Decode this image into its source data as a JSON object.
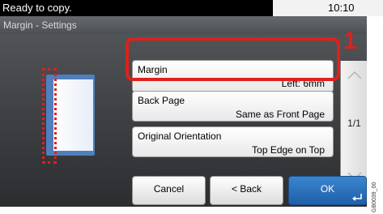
{
  "status": {
    "message": "Ready to copy.",
    "time": "10:10"
  },
  "screen_title": "Margin - Settings",
  "options": [
    {
      "label": "Margin",
      "value": "Left: 6mm"
    },
    {
      "label": "Back Page",
      "value": "Same as Front Page"
    },
    {
      "label": "Original Orientation",
      "value": "Top Edge on Top"
    }
  ],
  "callout_number": "1",
  "pagination": "1/1",
  "buttons": {
    "cancel": "Cancel",
    "back": "< Back",
    "ok": "OK"
  },
  "figure_code": "GB0039_00",
  "colors": {
    "highlight": "#e0201b",
    "ok_button": "#2a6fbd",
    "status_bar": "#000000"
  }
}
